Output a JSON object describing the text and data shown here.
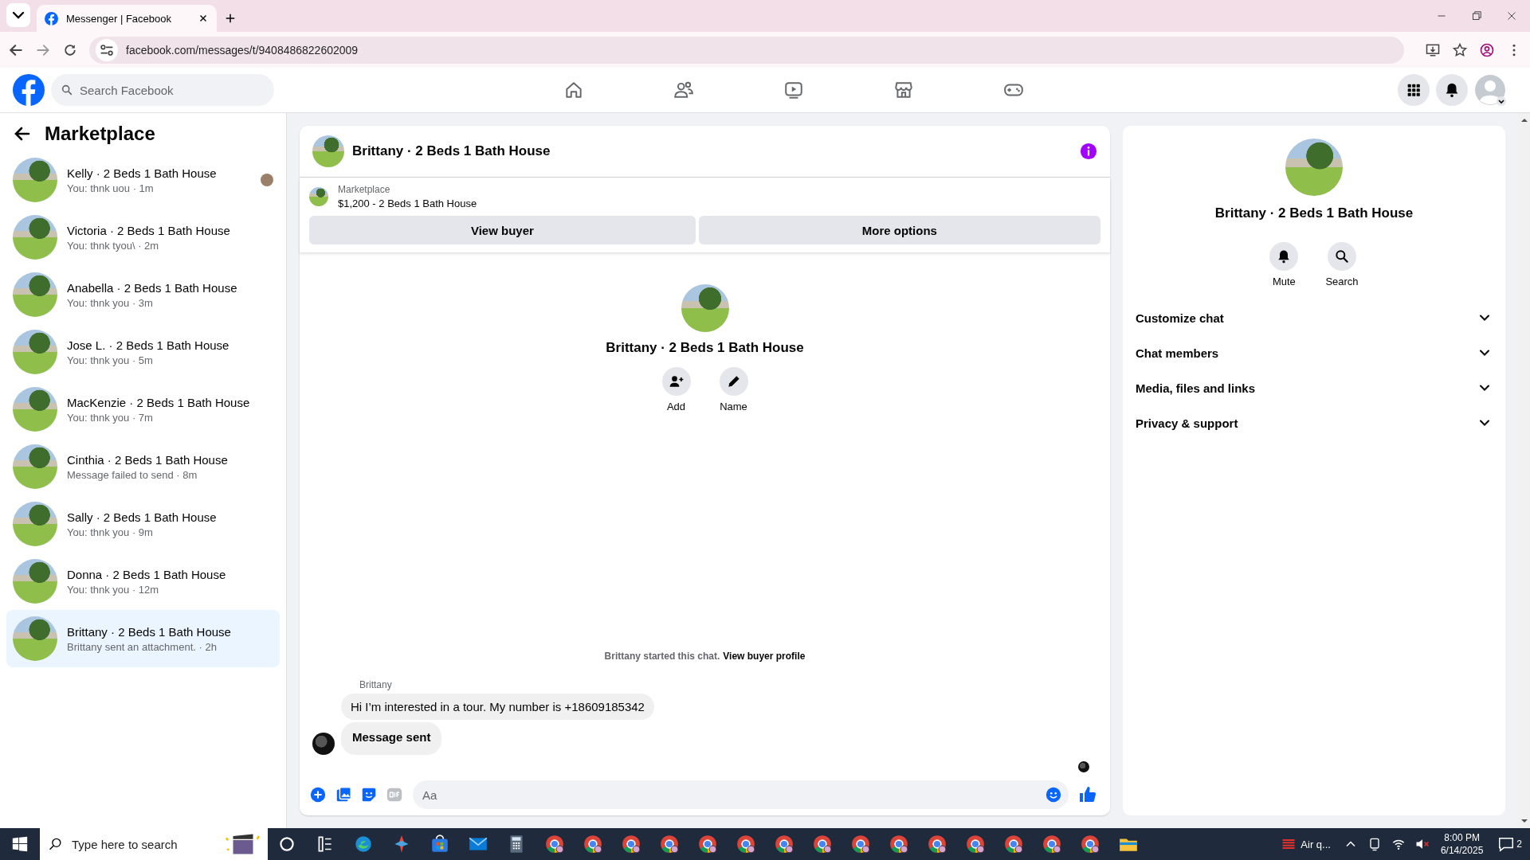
{
  "browser": {
    "tab_title": "Messenger | Facebook",
    "url": "facebook.com/messages/t/9408486822602009"
  },
  "header": {
    "search_placeholder": "Search Facebook"
  },
  "sidebar": {
    "title": "Marketplace",
    "conversations": [
      {
        "name": "Kelly · 2 Beds 1 Bath House",
        "preview": "You: thnk uou · 1m",
        "seen": true,
        "selected": false
      },
      {
        "name": "Victoria · 2 Beds 1 Bath House",
        "preview": "You: thnk tyou\\ · 2m",
        "seen": false,
        "selected": false
      },
      {
        "name": "Anabella · 2 Beds 1 Bath House",
        "preview": "You: thnk you · 3m",
        "seen": false,
        "selected": false
      },
      {
        "name": "Jose L. · 2 Beds 1 Bath House",
        "preview": "You: thnk you · 5m",
        "seen": false,
        "selected": false
      },
      {
        "name": "MacKenzie · 2 Beds 1 Bath House",
        "preview": "You: thnk you · 7m",
        "seen": false,
        "selected": false
      },
      {
        "name": "Cinthia · 2 Beds 1 Bath House",
        "preview": "Message failed to send · 8m",
        "seen": false,
        "selected": false
      },
      {
        "name": "Sally · 2 Beds 1 Bath House",
        "preview": "You: thnk you · 9m",
        "seen": false,
        "selected": false
      },
      {
        "name": "Donna · 2 Beds 1 Bath House",
        "preview": "You: thnk you · 12m",
        "seen": false,
        "selected": false
      },
      {
        "name": "Brittany · 2 Beds 1 Bath House",
        "preview": "Brittany sent an attachment. · 2h",
        "seen": false,
        "selected": true
      }
    ]
  },
  "chat": {
    "title": "Brittany · 2 Beds 1 Bath House",
    "listing": {
      "label": "Marketplace",
      "item": "$1,200 - 2 Beds 1 Bath House"
    },
    "buttons": [
      "View buyer",
      "More options"
    ],
    "intro": {
      "name": "Brittany · 2 Beds 1 Bath House",
      "actions": [
        {
          "kind": "add",
          "label": "Add"
        },
        {
          "kind": "name",
          "label": "Name"
        }
      ]
    },
    "started": {
      "text": "Brittany started this chat.",
      "link": "View buyer profile"
    },
    "sender": "Brittany",
    "messages": [
      {
        "kind": "text",
        "text": "Hi I’m interested in a tour. My number is +18609185342"
      },
      {
        "kind": "notice",
        "text": "Message sent"
      }
    ],
    "composer_placeholder": "Aa"
  },
  "details": {
    "name": "Brittany · 2 Beds 1 Bath House",
    "actions": [
      {
        "kind": "mute",
        "label": "Mute"
      },
      {
        "kind": "search",
        "label": "Search"
      }
    ],
    "sections": [
      {
        "label": "Customize chat",
        "expanded": false
      },
      {
        "label": "Chat members",
        "expanded": false
      },
      {
        "label": "Media, files and links",
        "expanded": false
      },
      {
        "label": "Privacy & support",
        "expanded": false
      }
    ]
  },
  "taskbar": {
    "search_placeholder": "Type here to search",
    "weather": "Air q...",
    "time": "8:00 PM",
    "date": "6/14/2025",
    "notifications": "2"
  }
}
